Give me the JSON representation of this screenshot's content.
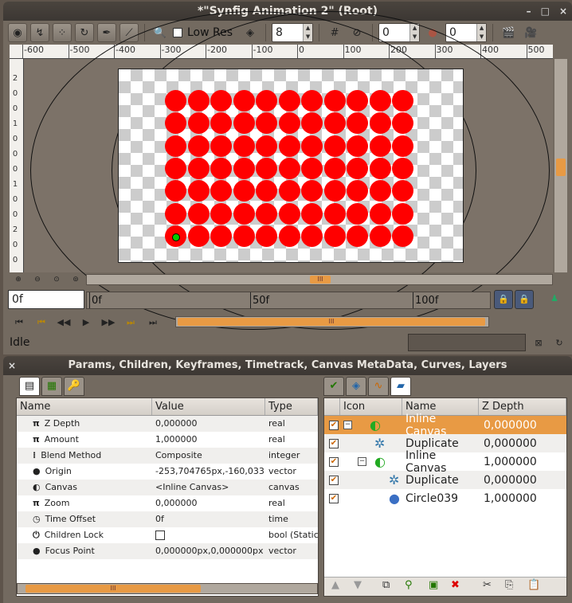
{
  "window1": {
    "title": "*\"Synfig Animation 2\" (Root)",
    "controls": [
      "–",
      "□",
      "×"
    ]
  },
  "toolbar": {
    "low_res_label": "Low Res",
    "resolution_value": "8",
    "onion_past": "0",
    "onion_future": "0"
  },
  "ruler": {
    "h_ticks": [
      "-600",
      "-500",
      "-400",
      "-300",
      "-200",
      "-100",
      "0",
      "100",
      "200",
      "300",
      "400",
      "500"
    ],
    "v_ticks": [
      "2",
      "0",
      "0",
      "1",
      "0",
      "0",
      "0",
      "1",
      "0",
      "0",
      "2",
      "0",
      "0"
    ]
  },
  "timeline": {
    "current_time": "0f",
    "labels": [
      "0f",
      "50f",
      "100f"
    ]
  },
  "status": {
    "text": "Idle"
  },
  "window2": {
    "title": "Params, Children, Keyframes, Timetrack, Canvas MetaData, Curves, Layers"
  },
  "params": {
    "headers": [
      "Name",
      "Value",
      "Type"
    ],
    "rows": [
      {
        "icon": "π",
        "name": "Z Depth",
        "value": "0,000000",
        "type": "real"
      },
      {
        "icon": "π",
        "name": "Amount",
        "value": "1,000000",
        "type": "real"
      },
      {
        "icon": "⁞",
        "name": "Blend Method",
        "value": "Composite",
        "type": "integer"
      },
      {
        "icon": "●",
        "name": "Origin",
        "value": "-253,704765px,-160,033",
        "type": "vector"
      },
      {
        "icon": "◐",
        "name": "Canvas",
        "value": "<Inline Canvas>",
        "type": "canvas"
      },
      {
        "icon": "π",
        "name": "Zoom",
        "value": "0,000000",
        "type": "real"
      },
      {
        "icon": "◷",
        "name": "Time Offset",
        "value": "0f",
        "type": "time"
      },
      {
        "icon": "⏻",
        "name": "Children Lock",
        "value": "",
        "type": "bool (Static"
      },
      {
        "icon": "●",
        "name": "Focus Point",
        "value": "0,000000px,0,000000px",
        "type": "vector"
      }
    ]
  },
  "layers": {
    "headers": [
      "Icon",
      "Name",
      "Z Depth"
    ],
    "rows": [
      {
        "name": "Inline Canvas",
        "zdepth": "0,000000"
      },
      {
        "name": "Duplicate",
        "zdepth": "0,000000"
      },
      {
        "name": "Inline Canvas",
        "zdepth": "1,000000"
      },
      {
        "name": "Duplicate",
        "zdepth": "0,000000"
      },
      {
        "name": "Circle039",
        "zdepth": "1,000000"
      }
    ]
  },
  "colors": {
    "accent": "#e89a44",
    "circle": "#ff0000",
    "chrome": "#736a60"
  }
}
